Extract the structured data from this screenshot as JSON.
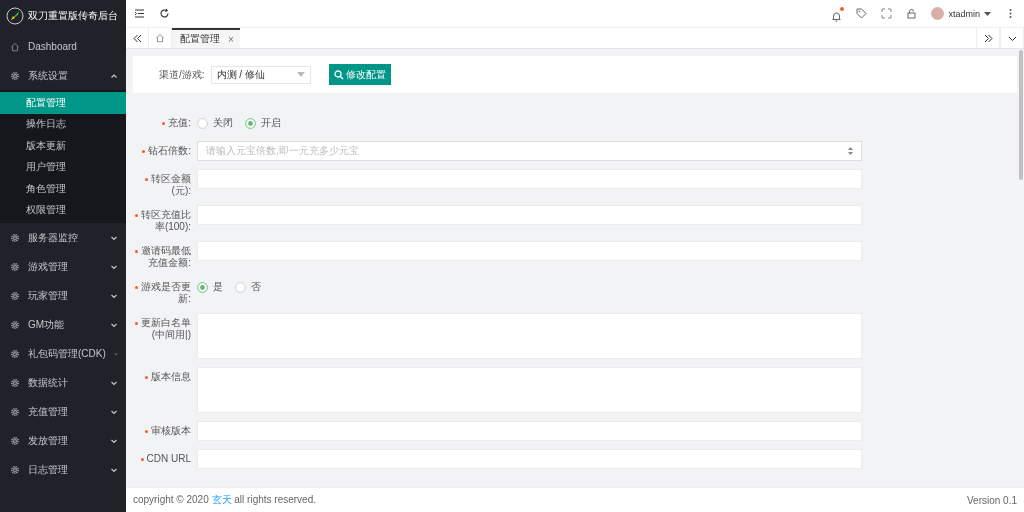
{
  "app_title": "双刀重置版传奇后台",
  "sidebar": [
    {
      "label": "Dashboard",
      "kind": "home"
    },
    {
      "label": "系统设置",
      "kind": "group",
      "expanded": true,
      "children": [
        {
          "label": "配置管理",
          "selected": true
        },
        {
          "label": "操作日志",
          "selected": false
        },
        {
          "label": "版本更新",
          "selected": false
        },
        {
          "label": "用户管理",
          "selected": false
        },
        {
          "label": "角色管理",
          "selected": false
        },
        {
          "label": "权限管理",
          "selected": false
        }
      ]
    },
    {
      "label": "服务器监控",
      "kind": "group",
      "expanded": false
    },
    {
      "label": "游戏管理",
      "kind": "group",
      "expanded": false
    },
    {
      "label": "玩家管理",
      "kind": "group",
      "expanded": false
    },
    {
      "label": "GM功能",
      "kind": "group",
      "expanded": false
    },
    {
      "label": "礼包码管理(CDK)",
      "kind": "group",
      "expanded": false
    },
    {
      "label": "数据统计",
      "kind": "group",
      "expanded": false
    },
    {
      "label": "充值管理",
      "kind": "group",
      "expanded": false
    },
    {
      "label": "发放管理",
      "kind": "group",
      "expanded": false
    },
    {
      "label": "日志管理",
      "kind": "group",
      "expanded": false
    }
  ],
  "header": {
    "user": "xtadmin",
    "notification_dot": true
  },
  "tabs": [
    {
      "label": "配置管理",
      "selected": true,
      "close": "×"
    }
  ],
  "filter": {
    "label": "渠道/游戏:",
    "value": "内测 / 修仙",
    "button": "修改配置"
  },
  "form": [
    {
      "kind": "radio",
      "required": true,
      "label": "充值:",
      "options": [
        {
          "label": "关闭",
          "selected": false
        },
        {
          "label": "开启",
          "selected": true
        }
      ]
    },
    {
      "kind": "number",
      "required": true,
      "label": "钻石倍数:",
      "placeholder": "请输入元宝倍数,即一元充多少元宝"
    },
    {
      "kind": "input",
      "required": true,
      "label": "转区金额(元):"
    },
    {
      "kind": "input",
      "required": true,
      "label": "转区充值比率(100):"
    },
    {
      "kind": "input",
      "required": true,
      "label": "邀请码最低充值金额:"
    },
    {
      "kind": "radio",
      "required": true,
      "label": "游戏是否更新:",
      "options": [
        {
          "label": "是",
          "selected": true
        },
        {
          "label": "否",
          "selected": false
        }
      ]
    },
    {
      "kind": "textarea",
      "required": true,
      "label": "更新白名单(中间用|)"
    },
    {
      "kind": "textarea",
      "required": true,
      "label": "版本信息"
    },
    {
      "kind": "input",
      "required": true,
      "label": "审核版本"
    },
    {
      "kind": "input",
      "required": true,
      "label": "CDN URL"
    }
  ],
  "footer": {
    "copyright": "copyright © 2020 ",
    "link": "玄天",
    "rest": " all rights reserved.",
    "version": "Version 0.1"
  }
}
